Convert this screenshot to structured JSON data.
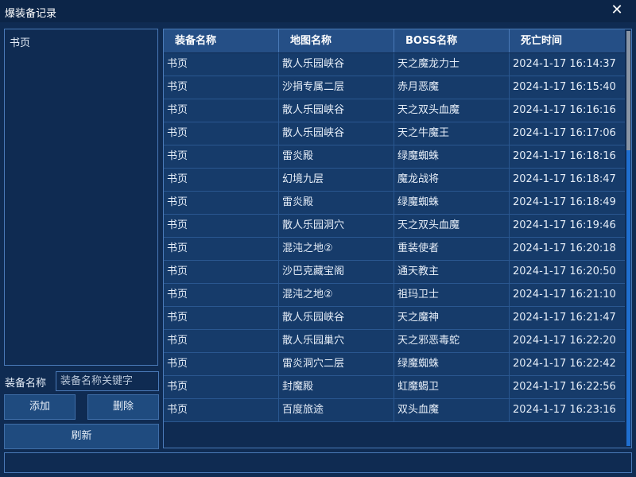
{
  "window": {
    "title": "爆装备记录",
    "close_glyph": "✕"
  },
  "left_panel": {
    "items": [
      "书页"
    ]
  },
  "form": {
    "name_label": "装备名称",
    "name_placeholder": "装备名称关键字",
    "name_value": "",
    "add_label": "添加",
    "delete_label": "删除",
    "refresh_label": "刷新"
  },
  "table": {
    "headers": [
      "装备名称",
      "地图名称",
      "BOSS名称",
      "死亡时间"
    ],
    "rows": [
      [
        "书页",
        "散人乐园峡谷",
        "天之魔龙力士",
        "2024-1-17 16:14:37"
      ],
      [
        "书页",
        "沙捐专属二层",
        "赤月恶魔",
        "2024-1-17 16:15:40"
      ],
      [
        "书页",
        "散人乐园峡谷",
        "天之双头血魔",
        "2024-1-17 16:16:16"
      ],
      [
        "书页",
        "散人乐园峡谷",
        "天之牛魔王",
        "2024-1-17 16:17:06"
      ],
      [
        "书页",
        "雷炎殿",
        "绿魔蜘蛛",
        "2024-1-17 16:18:16"
      ],
      [
        "书页",
        "幻境九层",
        "魔龙战将",
        "2024-1-17 16:18:47"
      ],
      [
        "书页",
        "雷炎殿",
        "绿魔蜘蛛",
        "2024-1-17 16:18:49"
      ],
      [
        "书页",
        "散人乐园洞穴",
        "天之双头血魔",
        "2024-1-17 16:19:46"
      ],
      [
        "书页",
        "混沌之地②",
        "重装使者",
        "2024-1-17 16:20:18"
      ],
      [
        "书页",
        "沙巴克藏宝阁",
        "通天教主",
        "2024-1-17 16:20:50"
      ],
      [
        "书页",
        "混沌之地②",
        "祖玛卫士",
        "2024-1-17 16:21:10"
      ],
      [
        "书页",
        "散人乐园峡谷",
        "天之魔神",
        "2024-1-17 16:21:47"
      ],
      [
        "书页",
        "散人乐园巢穴",
        "天之邪恶毒蛇",
        "2024-1-17 16:22:20"
      ],
      [
        "书页",
        "雷炎洞穴二层",
        "绿魔蜘蛛",
        "2024-1-17 16:22:42"
      ],
      [
        "书页",
        "封魔殿",
        "虹魔蝎卫",
        "2024-1-17 16:22:56"
      ],
      [
        "书页",
        "百度旅途",
        "双头血魔",
        "2024-1-17 16:23:16"
      ]
    ]
  },
  "statusbar": {
    "text": ""
  },
  "colors": {
    "background": "#0f2b52",
    "header_bg": "#254f86",
    "row_bg": "#163b6a",
    "border": "#4a7ab8",
    "scroll_accent": "#1f6fd0"
  }
}
